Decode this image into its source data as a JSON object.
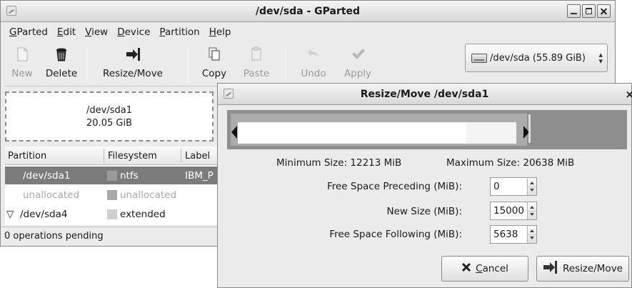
{
  "main_window": {
    "title": "/dev/sda - GParted",
    "menu": [
      {
        "label": "GParted"
      },
      {
        "label": "Edit"
      },
      {
        "label": "View"
      },
      {
        "label": "Device"
      },
      {
        "label": "Partition"
      },
      {
        "label": "Help"
      }
    ],
    "toolbar": {
      "new": "New",
      "delete": "Delete",
      "resize_move": "Resize/Move",
      "copy": "Copy",
      "paste": "Paste",
      "undo": "Undo",
      "apply": "Apply"
    },
    "device_selector": {
      "value": "/dev/sda  (55.89 GiB)"
    },
    "partition_graphic": {
      "name": "/dev/sda1",
      "size": "20.05 GiB"
    },
    "table": {
      "headers": [
        "Partition",
        "Filesystem",
        "Label"
      ],
      "rows": [
        {
          "partition": "/dev/sda1",
          "filesystem": "ntfs",
          "label": "IBM_P",
          "state": "selected",
          "fs_color": "#9a9a9a"
        },
        {
          "partition": "unallocated",
          "filesystem": "unallocated",
          "label": "",
          "state": "greyed",
          "fs_color": "#a9a9a9"
        },
        {
          "partition": "/dev/sda4",
          "filesystem": "extended",
          "label": "",
          "state": "normal",
          "fs_color": "#cfcfcf",
          "expander": "▽"
        }
      ]
    },
    "status": "0 operations pending"
  },
  "dialog": {
    "title": "Resize/Move /dev/sda1",
    "minimum_size": "Minimum Size: 12213 MiB",
    "maximum_size": "Maximum Size: 20638 MiB",
    "fields": {
      "free_preceding": {
        "label": "Free Space Preceding (MiB):",
        "value": "0"
      },
      "new_size": {
        "label": "New Size (MiB):",
        "value": "15000"
      },
      "free_following": {
        "label": "Free Space Following (MiB):",
        "value": "5638"
      }
    },
    "buttons": {
      "cancel": "Cancel",
      "resize_move": "Resize/Move"
    }
  },
  "colors": {
    "selected_row": "#7b7b7b",
    "window_bg": "#ebebeb"
  }
}
